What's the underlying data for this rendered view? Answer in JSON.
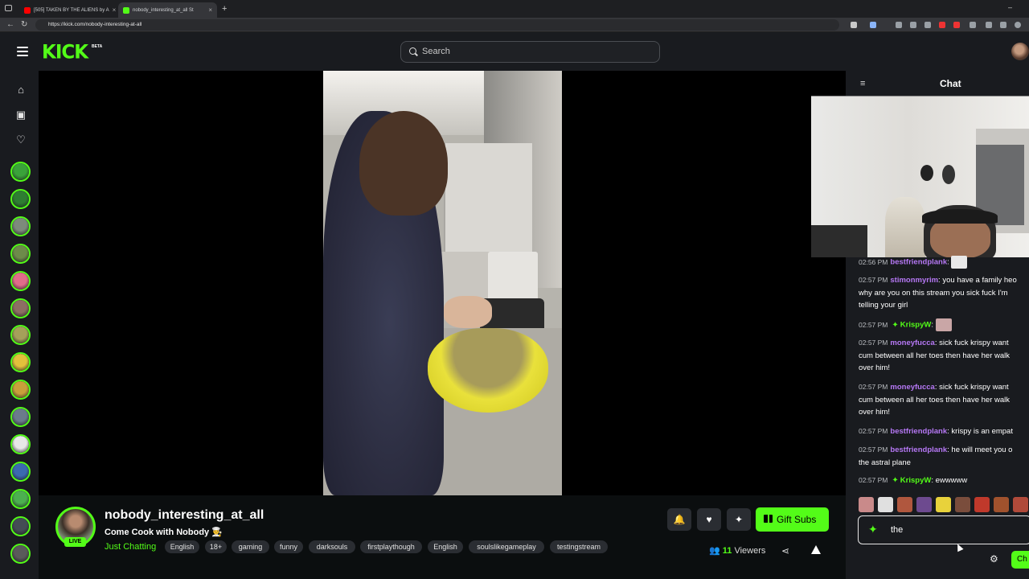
{
  "browser": {
    "tabs": [
      {
        "title": "[505] TAKEN BY THE ALIENS by A",
        "favicon_color": "#ff0000",
        "active": false
      },
      {
        "title": "nobody_interesting_at_all St",
        "favicon_color": "#53fc18",
        "active": true
      }
    ],
    "url": "https://kick.com/nobody-interesting-at-all"
  },
  "header": {
    "logo": "KICK",
    "logo_badge": "BETA",
    "search_placeholder": "Search"
  },
  "sidebar": {
    "nav_icons": [
      "home-icon",
      "browse-icon",
      "following-icon"
    ],
    "followed_channels": 15
  },
  "stream": {
    "streamer_name": "nobody_interesting_at_all",
    "live_label": "LIVE",
    "title": "Come Cook with Nobody 👨‍🍳",
    "category": "Just Chatting",
    "tags": [
      "English",
      "18+",
      "gaming",
      "funny",
      "darksouls",
      "firstplaythough",
      "English",
      "soulslikegameplay",
      "testingstream"
    ],
    "viewer_count": "11",
    "viewers_label": "Viewers",
    "gift_subs_label": "Gift Subs"
  },
  "chat": {
    "title": "Chat",
    "messages": [
      {
        "time": "02:56 PM",
        "user": "bestfriendplank",
        "user_color": "#b678f5",
        "text": "",
        "emote": true,
        "sparkle": false
      },
      {
        "time": "02:57 PM",
        "user": "stimonmyrim",
        "user_color": "#b678f5",
        "text": "you have a family heo",
        "cont": [
          "why are you on this stream you sick fuck I'm",
          "telling your girl"
        ],
        "sparkle": false
      },
      {
        "time": "02:57 PM",
        "user": "KrispyW",
        "user_color": "#53fc18",
        "text": "",
        "emote": true,
        "sparkle": true
      },
      {
        "time": "02:57 PM",
        "user": "moneyfucca",
        "user_color": "#b678f5",
        "text": "sick fuck krispy want",
        "cont": [
          "cum between all her toes then have her walk",
          "over him!"
        ],
        "sparkle": false
      },
      {
        "time": "02:57 PM",
        "user": "moneyfucca",
        "user_color": "#b678f5",
        "text": "sick fuck krispy want",
        "cont": [
          "cum between all her toes then have her walk",
          "over him!"
        ],
        "sparkle": false
      },
      {
        "time": "02:57 PM",
        "user": "bestfriendplank",
        "user_color": "#b678f5",
        "text": "krispy is an empat",
        "sparkle": false
      },
      {
        "time": "02:57 PM",
        "user": "bestfriendplank",
        "user_color": "#b678f5",
        "text": "he will meet you o",
        "cont": [
          "the astral plane"
        ],
        "sparkle": false
      },
      {
        "time": "02:57 PM",
        "user": "KrispyW",
        "user_color": "#53fc18",
        "text": "ewwwww",
        "sparkle": true
      }
    ],
    "input_value": "the",
    "send_label": "Ch"
  },
  "colors": {
    "accent": "#53fc18",
    "username": "#b678f5",
    "background": "#0b0e0f",
    "panel": "#191b1f"
  }
}
